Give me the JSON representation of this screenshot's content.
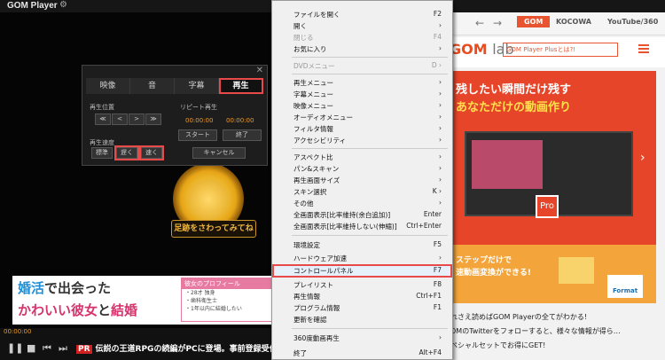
{
  "app": {
    "title": "GOM Player"
  },
  "player": {
    "footprint_button": "足跡をさわってみてね",
    "time": "00:00:00",
    "ticker_pr": "PR",
    "ticker": "伝説の王道RPGの続編がPCに登場。事前登録受付中"
  },
  "panel": {
    "tabs": [
      "映像",
      "音",
      "字幕",
      "再生"
    ],
    "playback_pos_label": "再生位置",
    "repeat_label": "リピート再生",
    "time_start": "00:00:00",
    "time_end": "00:00:00",
    "nav_buttons": [
      "≪",
      "<",
      ">",
      "≫"
    ],
    "start": "スタート",
    "end": "終了",
    "speed_label": "再生速度",
    "speed_buttons": [
      "標準",
      "遅く",
      "速く"
    ],
    "cancel": "キャンセル"
  },
  "banner": {
    "line1_accent": "婚活",
    "line1_rest": "で出会った",
    "line2_a": "かわいい彼女",
    "line2_b": "と",
    "line2_c": "結婚",
    "profile_title": "彼女のプロフィール",
    "profile_lines": [
      "・28才 独身",
      "・歯科衛生士",
      "・1年以内に結婚したい"
    ]
  },
  "browser": {
    "tabs": [
      "GOM",
      "KOCOWA",
      "YouTube/360"
    ],
    "logo_main": "GOM",
    "logo_sub": "lab",
    "search": "GOM Player Plusとは?!",
    "ad1_line1": "残したい瞬間だけ残す",
    "ad1_line2": "あなただけの動画作り",
    "ad1_icon_label": "Pro",
    "ad2_line1": "ステップだけで",
    "ad2_line2": "速動画変換ができる!",
    "ad2_doc": "Format",
    "news": [
      "れさえ読めばGOM Playerの全てがわかる!",
      "OMのTwitterをフォローすると、様々な情報が得ら…",
      "ペシャルセットでお得にGET!"
    ]
  },
  "menu": {
    "items": [
      {
        "label": "ファイルを開く",
        "shortcut": "F2",
        "state": "normal"
      },
      {
        "label": "開く",
        "shortcut": "›",
        "state": "normal"
      },
      {
        "label": "閉じる",
        "shortcut": "F4",
        "state": "disabled"
      },
      {
        "label": "お気に入り",
        "shortcut": "›",
        "state": "normal"
      },
      {
        "label": "DVDメニュー",
        "shortcut": "D ›",
        "state": "disabled"
      },
      {
        "label": "再生メニュー",
        "shortcut": "›",
        "state": "normal"
      },
      {
        "label": "字幕メニュー",
        "shortcut": "›",
        "state": "normal"
      },
      {
        "label": "映像メニュー",
        "shortcut": "›",
        "state": "normal"
      },
      {
        "label": "オーディオメニュー",
        "shortcut": "›",
        "state": "normal"
      },
      {
        "label": "フィルタ情報",
        "shortcut": "›",
        "state": "normal"
      },
      {
        "label": "アクセシビリティ",
        "shortcut": "›",
        "state": "normal"
      },
      {
        "label": "アスペクト比",
        "shortcut": "›",
        "state": "normal"
      },
      {
        "label": "パン&スキャン",
        "shortcut": "›",
        "state": "normal"
      },
      {
        "label": "再生画面サイズ",
        "shortcut": "›",
        "state": "normal"
      },
      {
        "label": "スキン選択",
        "shortcut": "K ›",
        "state": "normal"
      },
      {
        "label": "その他",
        "shortcut": "›",
        "state": "normal"
      },
      {
        "label": "全画面表示[比率維持(余白追加)]",
        "shortcut": "Enter",
        "state": "normal"
      },
      {
        "label": "全画面表示[比率維持しない(伸縮)]",
        "shortcut": "Ctrl+Enter",
        "state": "normal"
      },
      {
        "label": "環境設定",
        "shortcut": "F5",
        "state": "normal"
      },
      {
        "label": "ハードウェア加速",
        "shortcut": "›",
        "state": "normal"
      },
      {
        "label": "コントロールパネル",
        "shortcut": "F7",
        "state": "active"
      },
      {
        "label": "プレイリスト",
        "shortcut": "F8",
        "state": "normal"
      },
      {
        "label": "再生情報",
        "shortcut": "Ctrl+F1",
        "state": "normal"
      },
      {
        "label": "プログラム情報",
        "shortcut": "F1",
        "state": "normal"
      },
      {
        "label": "更新を確認",
        "shortcut": "",
        "state": "normal"
      },
      {
        "label": "360度動画再生",
        "shortcut": "›",
        "state": "normal"
      },
      {
        "label": "終了",
        "shortcut": "Alt+F4",
        "state": "normal"
      }
    ]
  }
}
